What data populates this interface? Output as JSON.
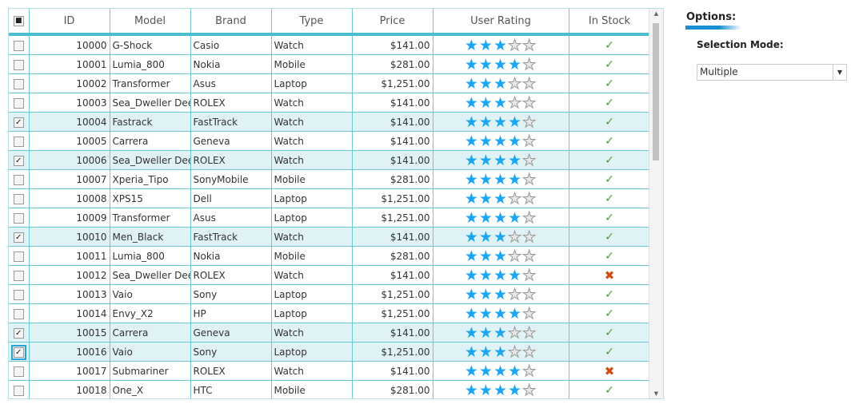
{
  "columns": [
    "ID",
    "Model",
    "Brand",
    "Type",
    "Price",
    "User Rating",
    "In Stock"
  ],
  "rows": [
    {
      "id": "10000",
      "model": "G-Shock",
      "brand": "Casio",
      "type": "Watch",
      "price": "$141.00",
      "rating": 3,
      "in_stock": true,
      "selected": false
    },
    {
      "id": "10001",
      "model": "Lumia_800",
      "brand": "Nokia",
      "type": "Mobile",
      "price": "$281.00",
      "rating": 4,
      "in_stock": true,
      "selected": false
    },
    {
      "id": "10002",
      "model": "Transformer",
      "brand": "Asus",
      "type": "Laptop",
      "price": "$1,251.00",
      "rating": 3,
      "in_stock": true,
      "selected": false
    },
    {
      "id": "10003",
      "model": "Sea_Dweller Deepsea",
      "brand": "ROLEX",
      "type": "Watch",
      "price": "$141.00",
      "rating": 3,
      "in_stock": true,
      "selected": false
    },
    {
      "id": "10004",
      "model": "Fastrack",
      "brand": "FastTrack",
      "type": "Watch",
      "price": "$141.00",
      "rating": 4,
      "in_stock": true,
      "selected": true
    },
    {
      "id": "10005",
      "model": "Carrera",
      "brand": "Geneva",
      "type": "Watch",
      "price": "$141.00",
      "rating": 4,
      "in_stock": true,
      "selected": false
    },
    {
      "id": "10006",
      "model": "Sea_Dweller Deepsea",
      "brand": "ROLEX",
      "type": "Watch",
      "price": "$141.00",
      "rating": 4,
      "in_stock": true,
      "selected": true
    },
    {
      "id": "10007",
      "model": "Xperia_Tipo",
      "brand": "SonyMobile",
      "type": "Mobile",
      "price": "$281.00",
      "rating": 4,
      "in_stock": true,
      "selected": false
    },
    {
      "id": "10008",
      "model": "XPS15",
      "brand": "Dell",
      "type": "Laptop",
      "price": "$1,251.00",
      "rating": 3,
      "in_stock": true,
      "selected": false
    },
    {
      "id": "10009",
      "model": "Transformer",
      "brand": "Asus",
      "type": "Laptop",
      "price": "$1,251.00",
      "rating": 4,
      "in_stock": true,
      "selected": false
    },
    {
      "id": "10010",
      "model": "Men_Black",
      "brand": "FastTrack",
      "type": "Watch",
      "price": "$141.00",
      "rating": 3,
      "in_stock": true,
      "selected": true
    },
    {
      "id": "10011",
      "model": "Lumia_800",
      "brand": "Nokia",
      "type": "Mobile",
      "price": "$281.00",
      "rating": 3,
      "in_stock": true,
      "selected": false
    },
    {
      "id": "10012",
      "model": "Sea_Dweller Deepsea",
      "brand": "ROLEX",
      "type": "Watch",
      "price": "$141.00",
      "rating": 4,
      "in_stock": false,
      "selected": false
    },
    {
      "id": "10013",
      "model": "Vaio",
      "brand": "Sony",
      "type": "Laptop",
      "price": "$1,251.00",
      "rating": 3,
      "in_stock": true,
      "selected": false
    },
    {
      "id": "10014",
      "model": "Envy_X2",
      "brand": "HP",
      "type": "Laptop",
      "price": "$1,251.00",
      "rating": 4,
      "in_stock": true,
      "selected": false
    },
    {
      "id": "10015",
      "model": "Carrera",
      "brand": "Geneva",
      "type": "Watch",
      "price": "$141.00",
      "rating": 3,
      "in_stock": true,
      "selected": true
    },
    {
      "id": "10016",
      "model": "Vaio",
      "brand": "Sony",
      "type": "Laptop",
      "price": "$1,251.00",
      "rating": 3,
      "in_stock": true,
      "selected": true,
      "focused": true
    },
    {
      "id": "10017",
      "model": "Submariner",
      "brand": "ROLEX",
      "type": "Watch",
      "price": "$141.00",
      "rating": 4,
      "in_stock": false,
      "selected": false
    },
    {
      "id": "10018",
      "model": "One_X",
      "brand": "HTC",
      "type": "Mobile",
      "price": "$281.00",
      "rating": 4,
      "in_stock": true,
      "selected": false
    }
  ],
  "options": {
    "title": "Options:",
    "selection_mode_label": "Selection Mode:",
    "selection_mode_value": "Multiple"
  },
  "colors": {
    "accent": "#4cbcd0",
    "star": "#1fa5ef",
    "check": "#4c9a3c",
    "cross": "#d24a12",
    "selected_row": "#dff2f5"
  }
}
